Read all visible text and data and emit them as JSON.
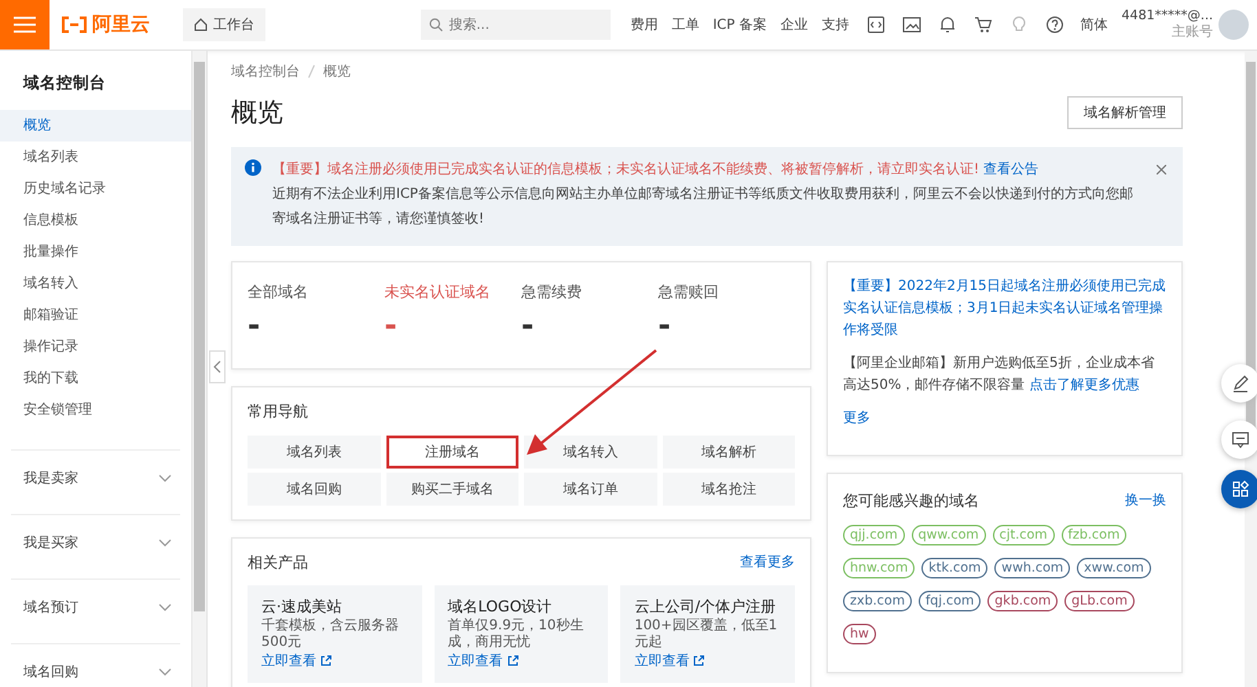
{
  "topbar": {
    "logo": "阿里云",
    "workbench": "工作台",
    "search": {
      "placeholder": "搜索..."
    },
    "links": [
      "费用",
      "工单",
      "ICP 备案",
      "企业",
      "支持"
    ],
    "language": "简体",
    "account": "4481*****@...",
    "account_role": "主账号"
  },
  "sidebar": {
    "title": "域名控制台",
    "items": [
      {
        "label": "概览",
        "selected": true
      },
      {
        "label": "域名列表",
        "selected": false
      },
      {
        "label": "历史域名记录",
        "selected": false
      },
      {
        "label": "信息模板",
        "selected": false
      },
      {
        "label": "批量操作",
        "selected": false
      },
      {
        "label": "域名转入",
        "selected": false
      },
      {
        "label": "邮箱验证",
        "selected": false
      },
      {
        "label": "操作记录",
        "selected": false
      },
      {
        "label": "我的下载",
        "selected": false
      },
      {
        "label": "安全锁管理",
        "selected": false
      }
    ],
    "groups": [
      {
        "label": "我是卖家",
        "expanded": false
      },
      {
        "label": "我是买家",
        "expanded": false
      },
      {
        "label": "域名预订",
        "expanded": false
      },
      {
        "label": "域名回购",
        "expanded": false
      }
    ]
  },
  "breadcrumb": [
    "域名控制台",
    "概览"
  ],
  "title": "概览",
  "header_button": "域名解析管理",
  "notice": {
    "important": "【重要】域名注册必须使用已完成实名认证的信息模板；未实名认证域名不能续费、将被暂停解析，请立即实名认证!",
    "link": "查看公告",
    "body": "近期有不法企业利用ICP备案信息等公示信息向网站主办单位邮寄域名注册证书等纸质文件收取费用获利，阿里云不会以快递到付的方式向您邮寄域名注册证书等，请您谨慎签收!"
  },
  "stats": [
    {
      "label": "全部域名",
      "value": "-",
      "alert": false
    },
    {
      "label": "未实名认证域名",
      "value": "-",
      "alert": true
    },
    {
      "label": "急需续费",
      "value": "-",
      "alert": false
    },
    {
      "label": "急需赎回",
      "value": "-",
      "alert": false
    }
  ],
  "nav": {
    "title": "常用导航",
    "items": [
      {
        "label": "域名列表",
        "highlighted": false
      },
      {
        "label": "注册域名",
        "highlighted": true
      },
      {
        "label": "域名转入",
        "highlighted": false
      },
      {
        "label": "域名解析",
        "highlighted": false
      },
      {
        "label": "域名回购",
        "highlighted": false
      },
      {
        "label": "购买二手域名",
        "highlighted": false
      },
      {
        "label": "域名订单",
        "highlighted": false
      },
      {
        "label": "域名抢注",
        "highlighted": false
      }
    ]
  },
  "products": {
    "title": "相关产品",
    "more": "查看更多",
    "cards": [
      {
        "title": "云·速成美站",
        "desc": "千套模板，含云服务器500元",
        "link": "立即查看"
      },
      {
        "title": "域名LOGO设计",
        "desc": "首单仅9.9元，10秒生成，商用无忧",
        "link": "立即查看"
      },
      {
        "title": "云上公司/个体户注册",
        "desc": "100+园区覆盖，低至1元起",
        "link": "立即查看"
      }
    ]
  },
  "news": {
    "items": [
      {
        "link": "【重要】2022年2月15日起域名注册必须使用已完成实名认证信息模板；3月1日起未实名认证域名管理操作将受限"
      },
      {
        "text": "【阿里企业邮箱】新用户选购低至5折，企业成本省高达50%，邮件存储不限容量 ",
        "link": "点击了解更多优惠"
      }
    ],
    "more": "更多"
  },
  "domains": {
    "title": "您可能感兴趣的域名",
    "refresh": "换一换",
    "chips": [
      {
        "name": "qjj.com",
        "color": "#7cbf62"
      },
      {
        "name": "qww.com",
        "color": "#7cbf62"
      },
      {
        "name": "cjt.com",
        "color": "#7cbf62"
      },
      {
        "name": "fzb.com",
        "color": "#7cbf62"
      },
      {
        "name": "hnw.com",
        "color": "#7cbf62"
      },
      {
        "name": "ktk.com",
        "color": "#50708f"
      },
      {
        "name": "wwh.com",
        "color": "#50708f"
      },
      {
        "name": "xww.com",
        "color": "#50708f"
      },
      {
        "name": "zxb.com",
        "color": "#50708f"
      },
      {
        "name": "fqj.com",
        "color": "#50708f"
      },
      {
        "name": "gkb.com",
        "color": "#a8485e"
      },
      {
        "name": "gLb.com",
        "color": "#a8485e"
      },
      {
        "name": "hw",
        "color": "#a8485e"
      }
    ]
  }
}
